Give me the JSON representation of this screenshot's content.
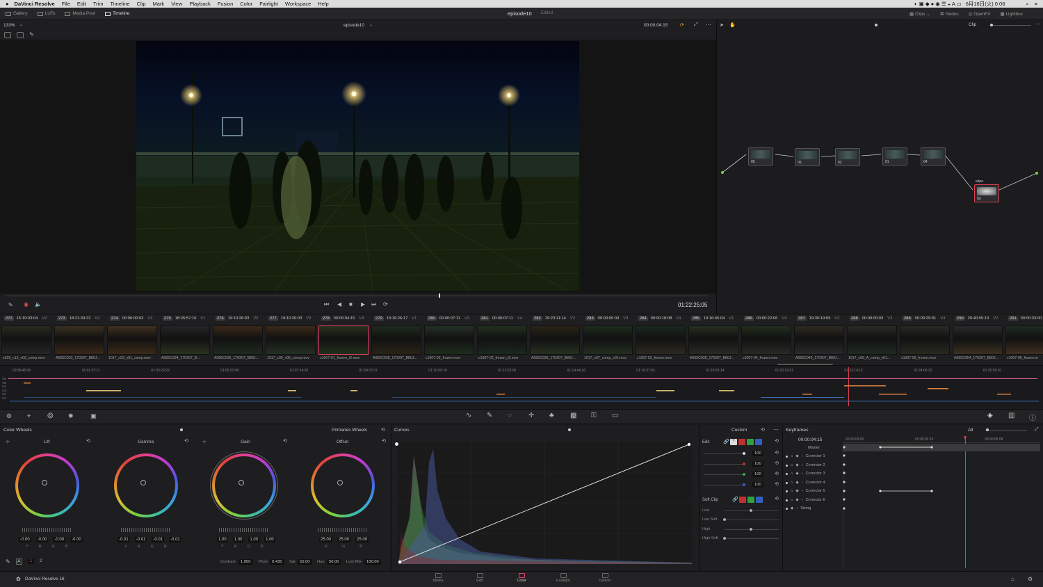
{
  "menubar": {
    "apple": "",
    "app": "DaVinci Resolve",
    "items": [
      "File",
      "Edit",
      "Trim",
      "Timeline",
      "Clip",
      "Mark",
      "View",
      "Playback",
      "Fusion",
      "Color",
      "Fairlight",
      "Workspace",
      "Help"
    ],
    "clock": "6月16日(火) 0:06"
  },
  "toolbar": {
    "left": [
      "Gallery",
      "LUTs",
      "Media Pool",
      "Timeline"
    ],
    "title": "episode10",
    "status": "Edited",
    "right": [
      "Clips",
      "Nodes",
      "OpenFX",
      "Lightbox"
    ]
  },
  "viewer": {
    "zoom": "133%",
    "timeline_name": "episode10",
    "timecode": "00:00:04:15",
    "mode": "Clip",
    "playhead_tc": "01:22:25:05"
  },
  "nodes": [
    {
      "label": "05"
    },
    {
      "label": "06"
    },
    {
      "label": "02"
    },
    {
      "label": "01"
    },
    {
      "label": "04"
    },
    {
      "label": "03",
      "title": "wipe"
    }
  ],
  "clips": [
    {
      "num": "272",
      "tc": "15:19:03:04",
      "track": "V2",
      "name": "c629_c13_v02_comp.mov"
    },
    {
      "num": "273",
      "tc": "18:21:39:22",
      "track": "V2",
      "name": "A055C033_170307_B80J..."
    },
    {
      "num": "274",
      "tc": "00:00:00:03",
      "track": "V3",
      "name": "1017_c03_v01_comp.mov"
    },
    {
      "num": "275",
      "tc": "18:26:57:10",
      "track": "V1",
      "name": "A055C034_170307_B..."
    },
    {
      "num": "276",
      "tc": "19:10:26:03",
      "track": "V2",
      "name": "A055C036_170307_B80J..."
    },
    {
      "num": "277",
      "tc": "19:10:26:03",
      "track": "V3",
      "name": "1017_c05_v05_comp.mov"
    },
    {
      "num": "278",
      "tc": "00:00:04:15",
      "track": "V4",
      "name": "c1007-01_frozen_t2.mov"
    },
    {
      "num": "279",
      "tc": "19:16:26:17",
      "track": "V1",
      "name": "A055C038_170307_B80J..."
    },
    {
      "num": "280",
      "tc": "00:00:07:11",
      "track": "V3",
      "name": "c1007-02_frozen.mov"
    },
    {
      "num": "281",
      "tc": "00:00:07:11",
      "track": "V4",
      "name": "c1007-02_frozen_t2.mov"
    },
    {
      "num": "282",
      "tc": "19:23:11:14",
      "track": "V2",
      "name": "A055C039_170307_B80J..."
    },
    {
      "num": "283",
      "tc": "00:00:00:03",
      "track": "V3",
      "name": "1017_c07_comp_v01.mov"
    },
    {
      "num": "284",
      "tc": "00:00:18:08",
      "track": "V4",
      "name": "c1007-03_frozen.mov"
    },
    {
      "num": "285",
      "tc": "19:16:45:04",
      "track": "V1",
      "name": "A055C038_170307_B80J..."
    },
    {
      "num": "286",
      "tc": "00:00:22:06",
      "track": "V4",
      "name": "c1007-04_frozen.mov"
    },
    {
      "num": "287",
      "tc": "19:30:19:09",
      "track": "V2",
      "name": "A055C040_170307_B80J..."
    },
    {
      "num": "288",
      "tc": "00:00:00:03",
      "track": "V3",
      "name": "1017_c09_A_comp_v01..."
    },
    {
      "num": "289",
      "tc": "00:00:29:01",
      "track": "V4",
      "name": "c1007-05_frozen.mov"
    },
    {
      "num": "290",
      "tc": "20:40:55:13",
      "track": "V2",
      "name": "A055C054_170307_B80J..."
    },
    {
      "num": "291",
      "tc": "00:00:33:00",
      "track": "",
      "name": "c1007-06_frozen.m"
    }
  ],
  "ruler": [
    "00:58:45:00",
    "01:01:37:11",
    "01:03:29:22",
    "01:05:22:09",
    "01:07:14:20",
    "01:09:07:07",
    "01:10:59:18",
    "01:12:52:05",
    "01:14:44:16",
    "01:16:37:03",
    "01:18:29:14",
    "01:20:22:01",
    "01:22:14:12",
    "01:24:06:23",
    "01:25:59:10"
  ],
  "tracks": [
    "V6",
    "V5",
    "V4",
    "V3",
    "V2",
    "V1"
  ],
  "colorwheels": {
    "title": "Color Wheels",
    "mode": "Primaries Wheels",
    "wheels": [
      {
        "name": "Lift",
        "values": [
          "-0.00",
          "-0.00",
          "-0.00",
          "-0.00"
        ]
      },
      {
        "name": "Gamma",
        "values": [
          "-0.01",
          "-0.01",
          "-0.01",
          "-0.01"
        ]
      },
      {
        "name": "Gain",
        "values": [
          "1.00",
          "1.00",
          "1.00",
          "1.00"
        ]
      },
      {
        "name": "Offset",
        "values": [
          "25.00",
          "25.00",
          "25.00"
        ]
      }
    ],
    "channels": [
      "Y",
      "R",
      "G",
      "B"
    ],
    "offset_channels": [
      "R",
      "G",
      "B"
    ],
    "pages": [
      "1",
      "2"
    ],
    "params": [
      {
        "label": "Contrast",
        "value": "1.000"
      },
      {
        "label": "Pivot",
        "value": "0.435"
      },
      {
        "label": "Sat",
        "value": "50.00"
      },
      {
        "label": "Hue",
        "value": "50.00"
      },
      {
        "label": "Lum Mix",
        "value": "100.00"
      }
    ]
  },
  "curves": {
    "title": "Curves",
    "mode": "Custom"
  },
  "curve_edit": {
    "edit_label": "Edit",
    "values": [
      "100",
      "100",
      "100",
      "100"
    ],
    "soft_clip": "Soft Clip",
    "soft": [
      "Low",
      "Low Soft",
      "High",
      "High Soft"
    ],
    "chips": [
      "Y",
      "R",
      "G",
      "B"
    ]
  },
  "keyframes": {
    "title": "Keyframes",
    "filter": "All",
    "tc": "00:00:04:15",
    "ruler": [
      "00:00:00:00",
      "00:00:02:16",
      "00:00:05:08"
    ],
    "rows": [
      "Master",
      "Corrector 1",
      "Corrector 2",
      "Corrector 3",
      "Corrector 4",
      "Corrector 5",
      "Corrector 6",
      "Sizing"
    ]
  },
  "pages_bar": {
    "app": "DaVinci Resolve 16",
    "items": [
      "Media",
      "Edit",
      "Color",
      "Fairlight",
      "Deliver"
    ],
    "active": "Color"
  }
}
